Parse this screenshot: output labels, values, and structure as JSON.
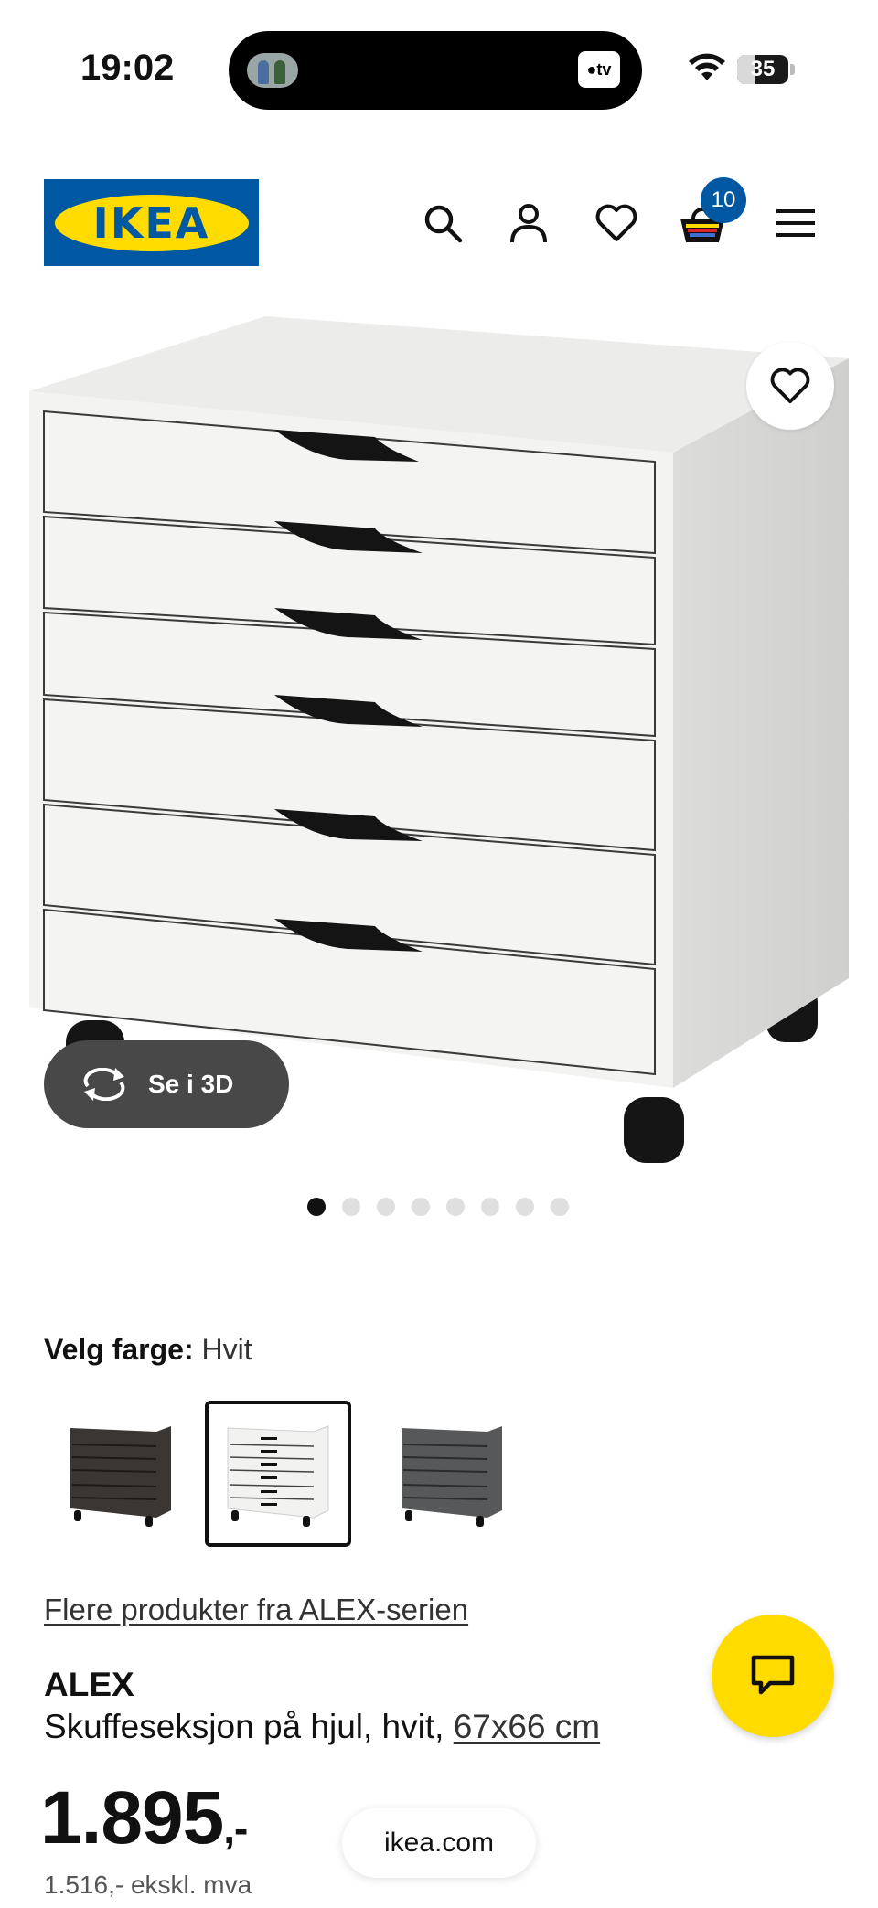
{
  "status_bar": {
    "time": "19:02",
    "battery": "35",
    "battery_level": 0.35,
    "tv_label": "tv"
  },
  "header": {
    "logo_text": "IKEA",
    "cart_count": "10"
  },
  "gallery": {
    "view_3d_label": "Se i 3D",
    "image_count": 8,
    "active_index": 0
  },
  "color_select": {
    "label": "Velg farge:",
    "value": "Hvit"
  },
  "swatches": [
    {
      "name": "black-brown",
      "color": "#3a3634",
      "selected": false
    },
    {
      "name": "white",
      "color": "#f2f2f0",
      "selected": true
    },
    {
      "name": "grey",
      "color": "#56585a",
      "selected": false
    }
  ],
  "series_link": "Flere produkter fra ALEX-serien",
  "product": {
    "name": "ALEX",
    "description": "Skuffeseksjon på hjul, hvit, ",
    "size": "67x66 cm",
    "price": "1.895",
    "price_suffix": ",-",
    "price_ex_vat": "1.516,- ekskl. mva"
  },
  "browser": {
    "url": "ikea.com"
  },
  "colors": {
    "ikea_blue": "#0058a3",
    "ikea_yellow": "#ffdb00"
  }
}
